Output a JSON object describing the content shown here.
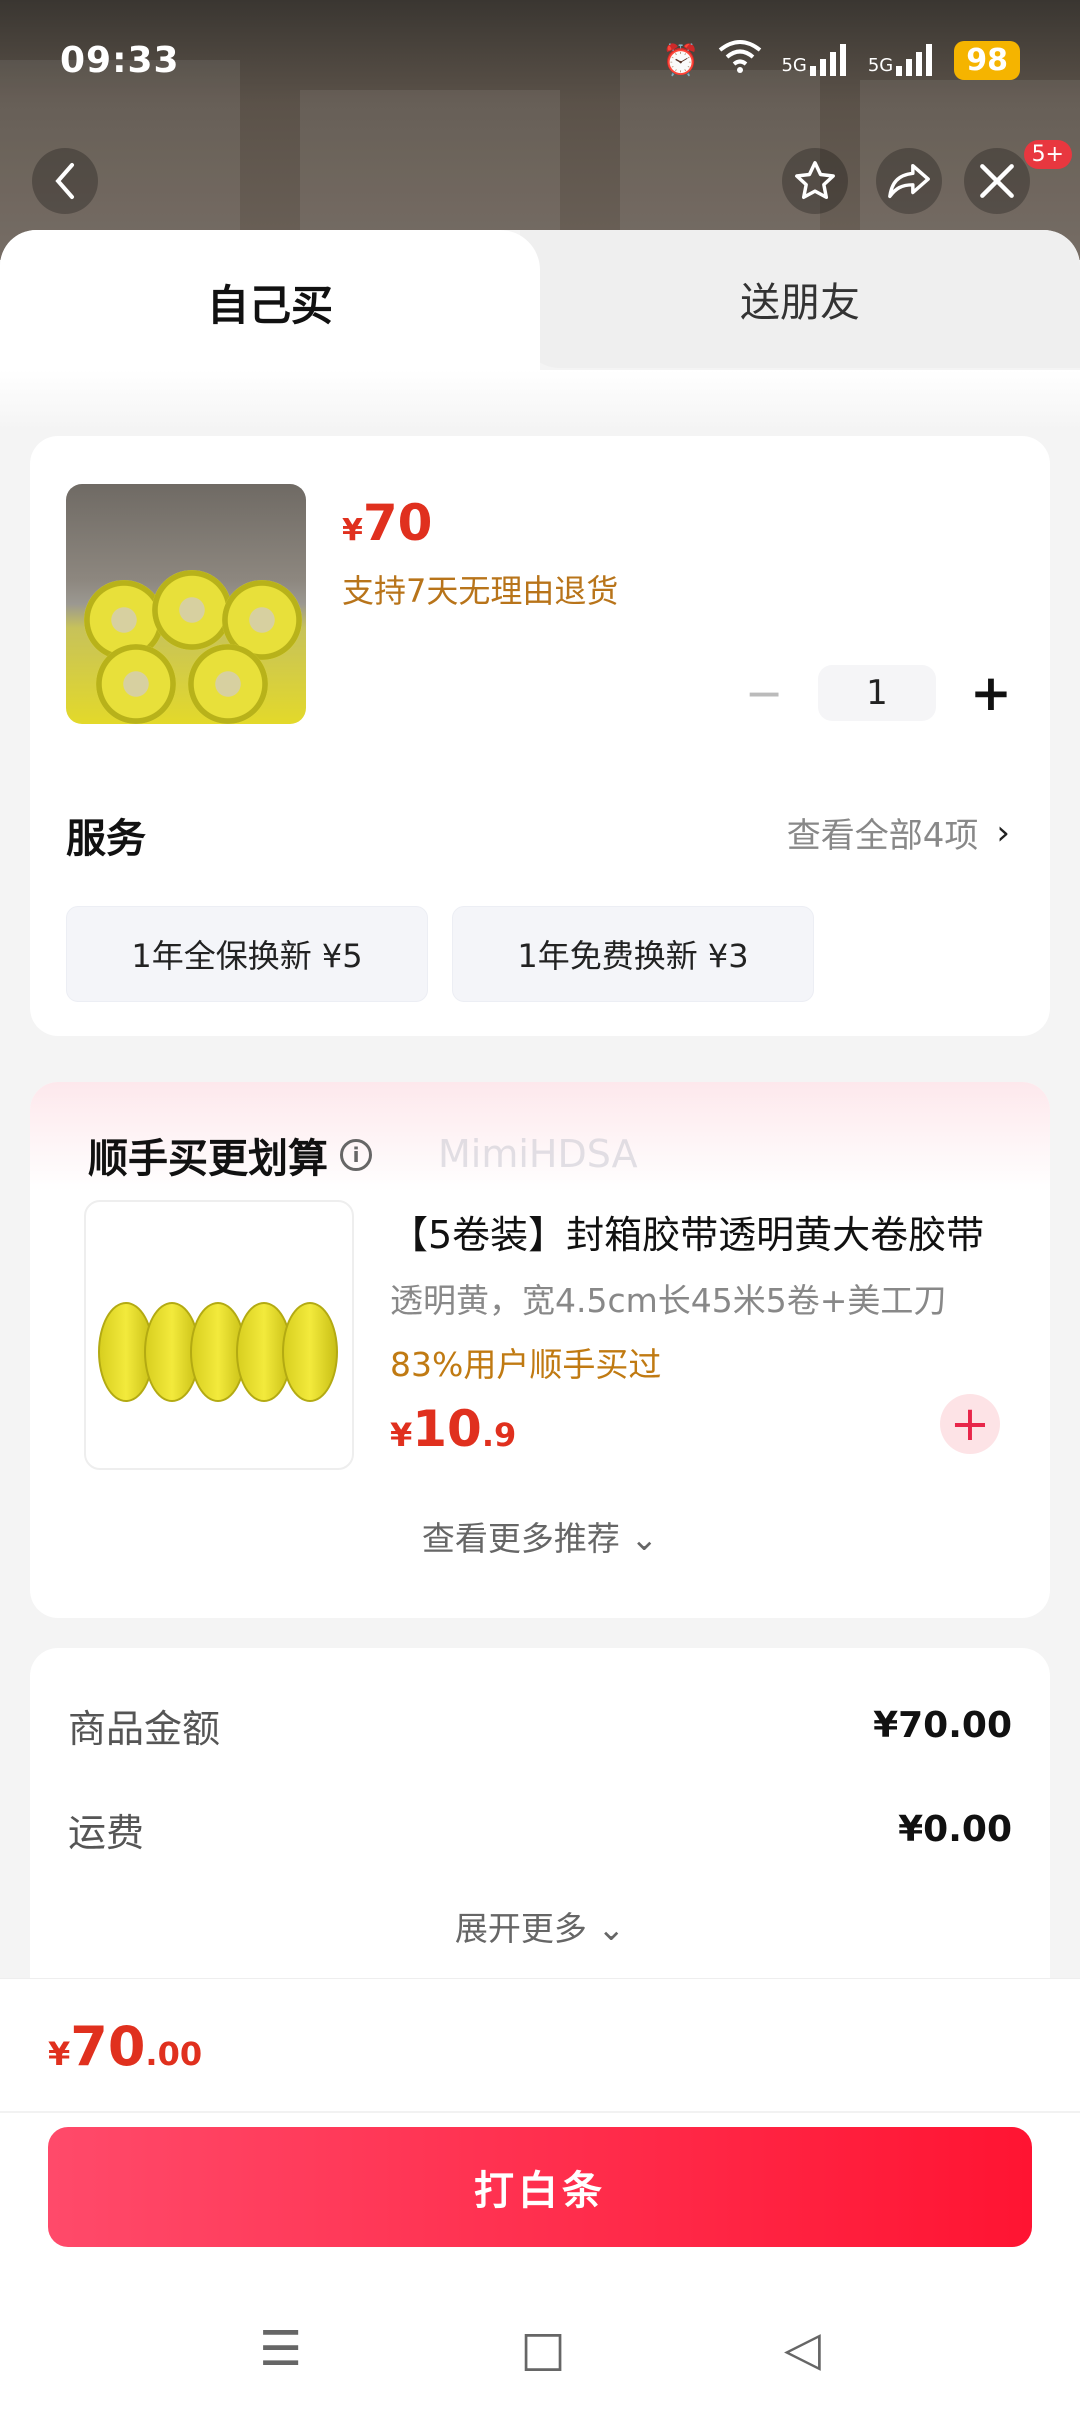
{
  "status_bar": {
    "time": "09:33",
    "battery": "98",
    "network_1": "5G",
    "network_2": "5G"
  },
  "header": {
    "back_icon": "chevron-left-icon",
    "notification_badge": "5+"
  },
  "tabs": {
    "self_buy": "自己买",
    "gift_friend": "送朋友"
  },
  "product": {
    "currency": "¥",
    "price": "70",
    "return_note": "支持7天无理由退货",
    "quantity": "1",
    "minus": "−",
    "plus": "+"
  },
  "services": {
    "title": "服务",
    "view_all": "查看全部4项",
    "chevron": "›",
    "options": [
      {
        "label": "1年全保换新  ¥5"
      },
      {
        "label": "1年免费换新  ¥3"
      }
    ]
  },
  "recommend": {
    "title": "顺手买更划算",
    "info": "i",
    "watermark": "MimiHDSA",
    "item_name": "【5卷装】封箱胶带透明黄大卷胶带",
    "item_spec": "透明黄，宽4.5cm长45米5卷+美工刀",
    "item_buy_rate": "83%用户顺手买过",
    "item_currency": "¥",
    "item_price_int": "10",
    "item_price_dec": ".9",
    "add": "+",
    "more": "查看更多推荐 ⌄"
  },
  "summary": {
    "goods_label": "商品金额",
    "goods_value": "¥70.00",
    "shipping_label": "运费",
    "shipping_value": "¥0.00",
    "expand": "展开更多 ⌄"
  },
  "footer": {
    "currency": "¥",
    "total_int": "70",
    "total_dec": ".00",
    "pay_button": "打白条"
  },
  "system_nav": {
    "menu": "☰",
    "home": "□",
    "back": "◁"
  }
}
